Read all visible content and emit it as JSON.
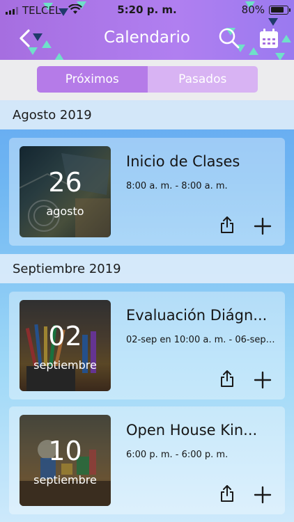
{
  "status_bar": {
    "carrier": "TELCEL",
    "time": "5:20 p. m.",
    "battery_percent": "80%",
    "battery_level": 0.8
  },
  "nav": {
    "title": "Calendario",
    "back_icon": "chevron-left-icon",
    "search_icon": "search-icon",
    "calendar_icon": "calendar-icon"
  },
  "tabs": [
    {
      "label": "Próximos",
      "active": true
    },
    {
      "label": "Pasados",
      "active": false
    }
  ],
  "sections": [
    {
      "header": "Agosto 2019",
      "events": [
        {
          "day": "26",
          "month": "agosto",
          "title": "Inicio de Clases",
          "time": "8:00 a. m. - 8:00 a. m."
        }
      ]
    },
    {
      "header": "Septiembre 2019",
      "events": [
        {
          "day": "02",
          "month": "septiembre",
          "title": "Evaluación Diágn...",
          "time": "02-sep en 10:00 a. m. - 06-sep e..."
        },
        {
          "day": "10",
          "month": "septiembre",
          "title": "Open House Kin...",
          "time": "6:00 p. m. - 6:00 p. m."
        }
      ]
    }
  ],
  "colors": {
    "accent": "#b57be8",
    "accent_light": "#d8b3f3",
    "header_purple": "#a66ee0",
    "triangle_teal": "#6fe0c9",
    "triangle_navy": "#1f3a6b"
  }
}
